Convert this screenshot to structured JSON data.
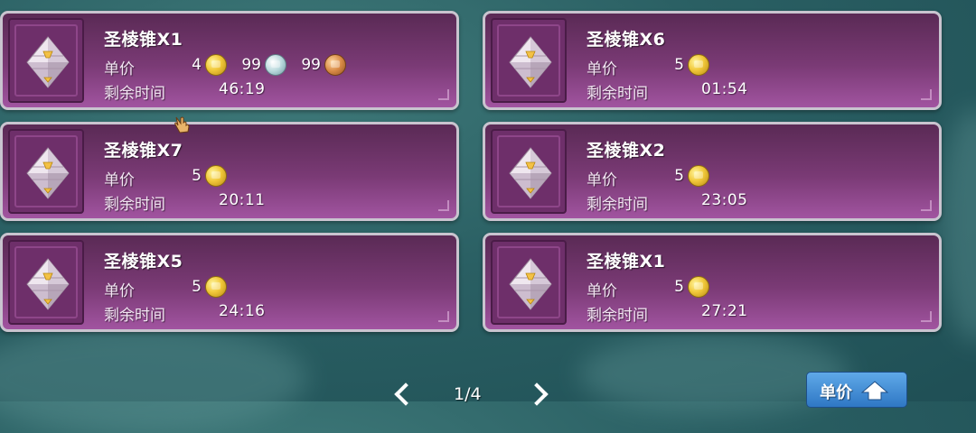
{
  "listings": [
    {
      "title": "圣棱锥X1",
      "price_label": "单价",
      "time_label": "剩余时间",
      "time": "46:19",
      "prices": [
        {
          "amount": "4",
          "currency": "gold-coin-icon"
        },
        {
          "amount": "99",
          "currency": "silver-coin-icon"
        },
        {
          "amount": "99",
          "currency": "bronze-coin-icon"
        }
      ]
    },
    {
      "title": "圣棱锥X6",
      "price_label": "单价",
      "time_label": "剩余时间",
      "time": "01:54",
      "prices": [
        {
          "amount": "5",
          "currency": "gold-coin-icon"
        }
      ]
    },
    {
      "title": "圣棱锥X7",
      "price_label": "单价",
      "time_label": "剩余时间",
      "time": "20:11",
      "prices": [
        {
          "amount": "5",
          "currency": "gold-coin-icon"
        }
      ]
    },
    {
      "title": "圣棱锥X2",
      "price_label": "单价",
      "time_label": "剩余时间",
      "time": "23:05",
      "prices": [
        {
          "amount": "5",
          "currency": "gold-coin-icon"
        }
      ]
    },
    {
      "title": "圣棱锥X5",
      "price_label": "单价",
      "time_label": "剩余时间",
      "time": "24:16",
      "prices": [
        {
          "amount": "5",
          "currency": "gold-coin-icon"
        }
      ]
    },
    {
      "title": "圣棱锥X1",
      "price_label": "单价",
      "time_label": "剩余时间",
      "time": "27:21",
      "prices": [
        {
          "amount": "5",
          "currency": "gold-coin-icon"
        }
      ]
    }
  ],
  "pagination": {
    "text": "1/4"
  },
  "sort_button": {
    "label": "单价",
    "icon": "up-arrow-icon"
  },
  "colors": {
    "card_top": "#5a2a55",
    "card_bottom": "#a154a0",
    "card_border": "#c9c4cf",
    "button_blue": "#2f77c4",
    "gold_coin": "#f1c83a",
    "silver_coin": "#b9d8dc",
    "bronze_coin": "#d88a46"
  }
}
